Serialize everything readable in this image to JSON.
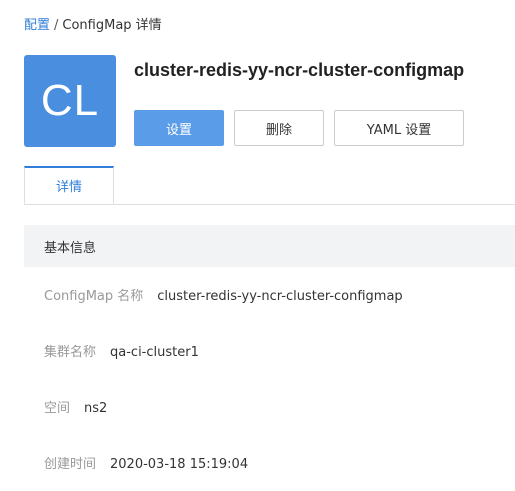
{
  "breadcrumb": {
    "parent": "配置",
    "separator": "/",
    "current": "ConfigMap 详情"
  },
  "resource": {
    "avatar_text": "CL",
    "avatar_color": "#4a8fdf",
    "title": "cluster-redis-yy-ncr-cluster-configmap"
  },
  "actions": {
    "settings_label": "设置",
    "delete_label": "删除",
    "yaml_settings_label": "YAML 设置",
    "primary_color": "#5b9ce8"
  },
  "tabs": {
    "details_label": "详情"
  },
  "basic_info": {
    "header": "基本信息",
    "fields": [
      {
        "label": "ConfigMap 名称",
        "value": "cluster-redis-yy-ncr-cluster-configmap"
      },
      {
        "label": "集群名称",
        "value": "qa-ci-cluster1"
      },
      {
        "label": "空间",
        "value": "ns2"
      },
      {
        "label": "创建时间",
        "value": "2020-03-18 15:19:04"
      }
    ]
  }
}
